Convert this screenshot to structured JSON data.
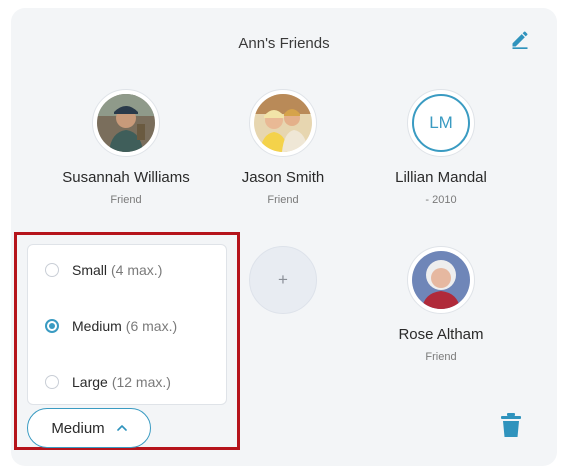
{
  "header": {
    "title": "Ann's Friends",
    "edit_icon": "pencil-icon",
    "accent_color": "#2f93bd"
  },
  "friends": [
    {
      "name": "Susannah Williams",
      "subtitle": "Friend",
      "avatar": "photo"
    },
    {
      "name": "Jason Smith",
      "subtitle": "Friend",
      "avatar": "photo"
    },
    {
      "name": "Lillian Mandal",
      "subtitle": "- 2010",
      "avatar": "initials",
      "initials": "LM"
    },
    {
      "name": "Rose Altham",
      "subtitle": "Friend",
      "avatar": "photo"
    }
  ],
  "add_slot": {
    "label": "+"
  },
  "size_menu": {
    "options": [
      {
        "label": "Small",
        "max": "(4 max.)",
        "selected": false
      },
      {
        "label": "Medium",
        "max": "(6 max.)",
        "selected": true
      },
      {
        "label": "Large",
        "max": "(12 max.)",
        "selected": false
      }
    ],
    "selected_label": "Medium",
    "chevron_icon": "chevron-up-icon"
  },
  "footer": {
    "delete_icon": "trash-icon"
  },
  "highlight_color": "#b5141b"
}
